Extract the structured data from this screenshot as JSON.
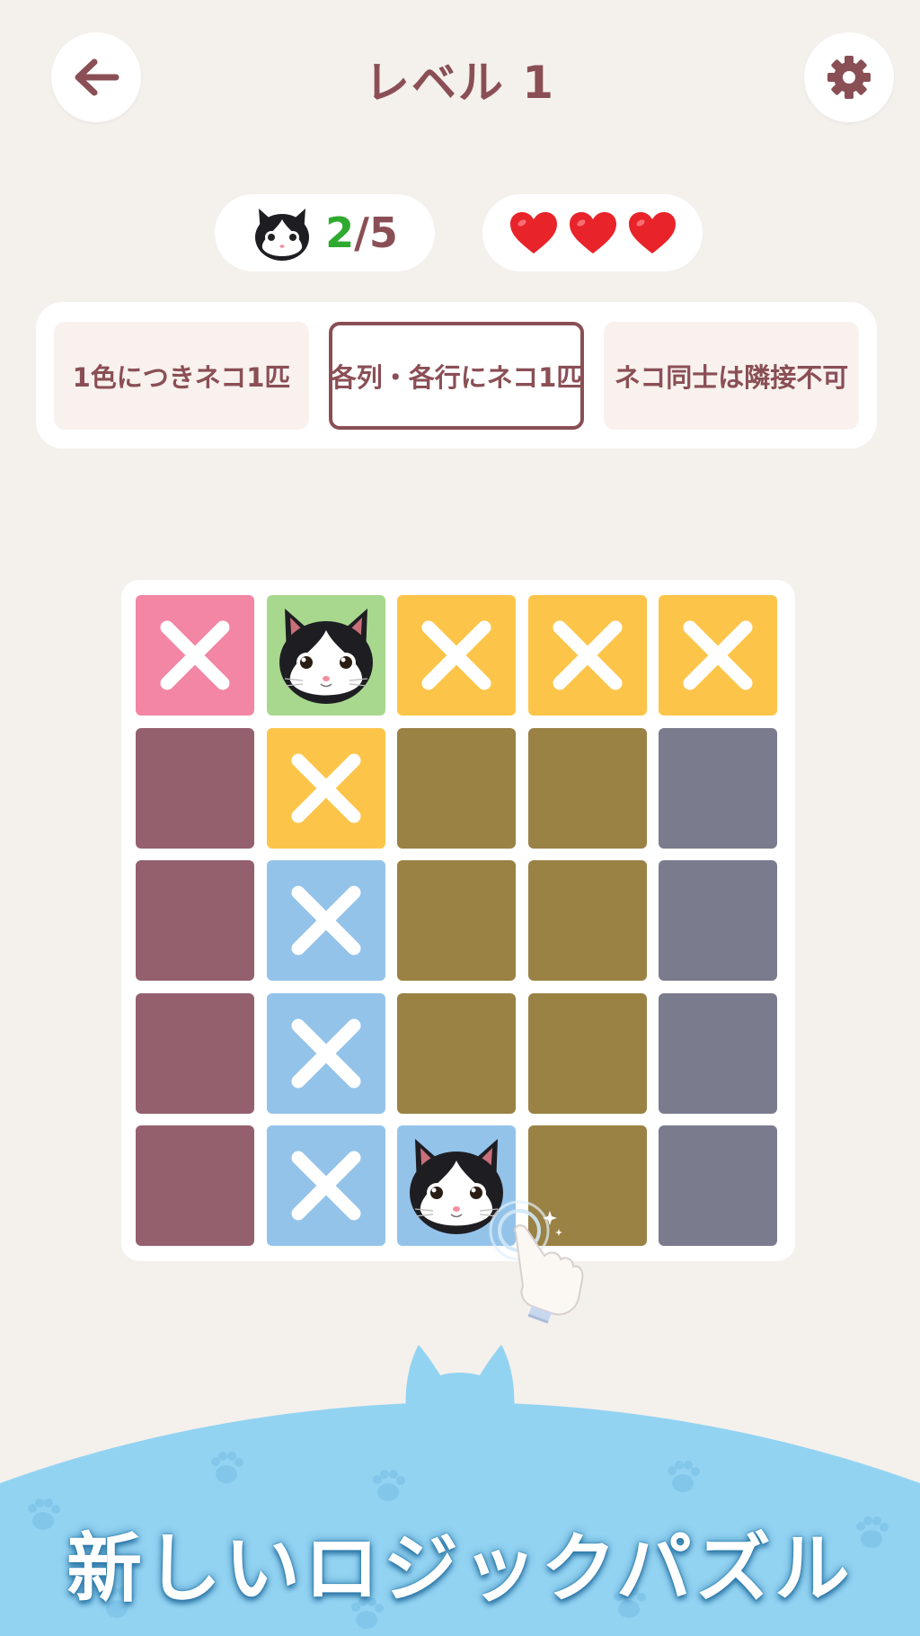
{
  "header": {
    "title": "レベル 1",
    "back_icon": "arrow-left-icon",
    "settings_icon": "gear-icon"
  },
  "counter": {
    "icon": "cat-face-icon",
    "current": "2",
    "separator": "/",
    "total": "5"
  },
  "lives": {
    "count": 3,
    "icon": "heart-icon",
    "color": "#e8232a"
  },
  "rules": [
    {
      "label": "1色につきネコ1匹",
      "active": false
    },
    {
      "label": "各列・各行にネコ1匹",
      "active": true
    },
    {
      "label": "ネコ同士は隣接不可",
      "active": false
    }
  ],
  "colors": {
    "pink": "#f286a4",
    "green": "#a8d88e",
    "yellow": "#fcc54a",
    "blue": "#94c3ea",
    "maroon": "#94606e",
    "olive": "#9a8144",
    "slate": "#7b7b8e",
    "accent": "#8a4f55"
  },
  "board": {
    "rows": 5,
    "cols": 5,
    "cells": [
      [
        {
          "color": "#f286a4",
          "mark": "x"
        },
        {
          "color": "#a8d88e",
          "mark": "cat"
        },
        {
          "color": "#fcc54a",
          "mark": "x"
        },
        {
          "color": "#fcc54a",
          "mark": "x"
        },
        {
          "color": "#fcc54a",
          "mark": "x"
        }
      ],
      [
        {
          "color": "#94606e",
          "mark": ""
        },
        {
          "color": "#fcc54a",
          "mark": "x"
        },
        {
          "color": "#9a8144",
          "mark": ""
        },
        {
          "color": "#9a8144",
          "mark": ""
        },
        {
          "color": "#7b7b8e",
          "mark": ""
        }
      ],
      [
        {
          "color": "#94606e",
          "mark": ""
        },
        {
          "color": "#94c3ea",
          "mark": "x"
        },
        {
          "color": "#9a8144",
          "mark": ""
        },
        {
          "color": "#9a8144",
          "mark": ""
        },
        {
          "color": "#7b7b8e",
          "mark": ""
        }
      ],
      [
        {
          "color": "#94606e",
          "mark": ""
        },
        {
          "color": "#94c3ea",
          "mark": "x"
        },
        {
          "color": "#9a8144",
          "mark": ""
        },
        {
          "color": "#9a8144",
          "mark": ""
        },
        {
          "color": "#7b7b8e",
          "mark": ""
        }
      ],
      [
        {
          "color": "#94606e",
          "mark": ""
        },
        {
          "color": "#94c3ea",
          "mark": "x"
        },
        {
          "color": "#94c3ea",
          "mark": "cat"
        },
        {
          "color": "#9a8144",
          "mark": ""
        },
        {
          "color": "#7b7b8e",
          "mark": ""
        }
      ]
    ]
  },
  "tap_hint_icon": "pointing-hand-icon",
  "banner": {
    "tagline": "新しいロジックパズル",
    "color": "#93d3f2"
  }
}
